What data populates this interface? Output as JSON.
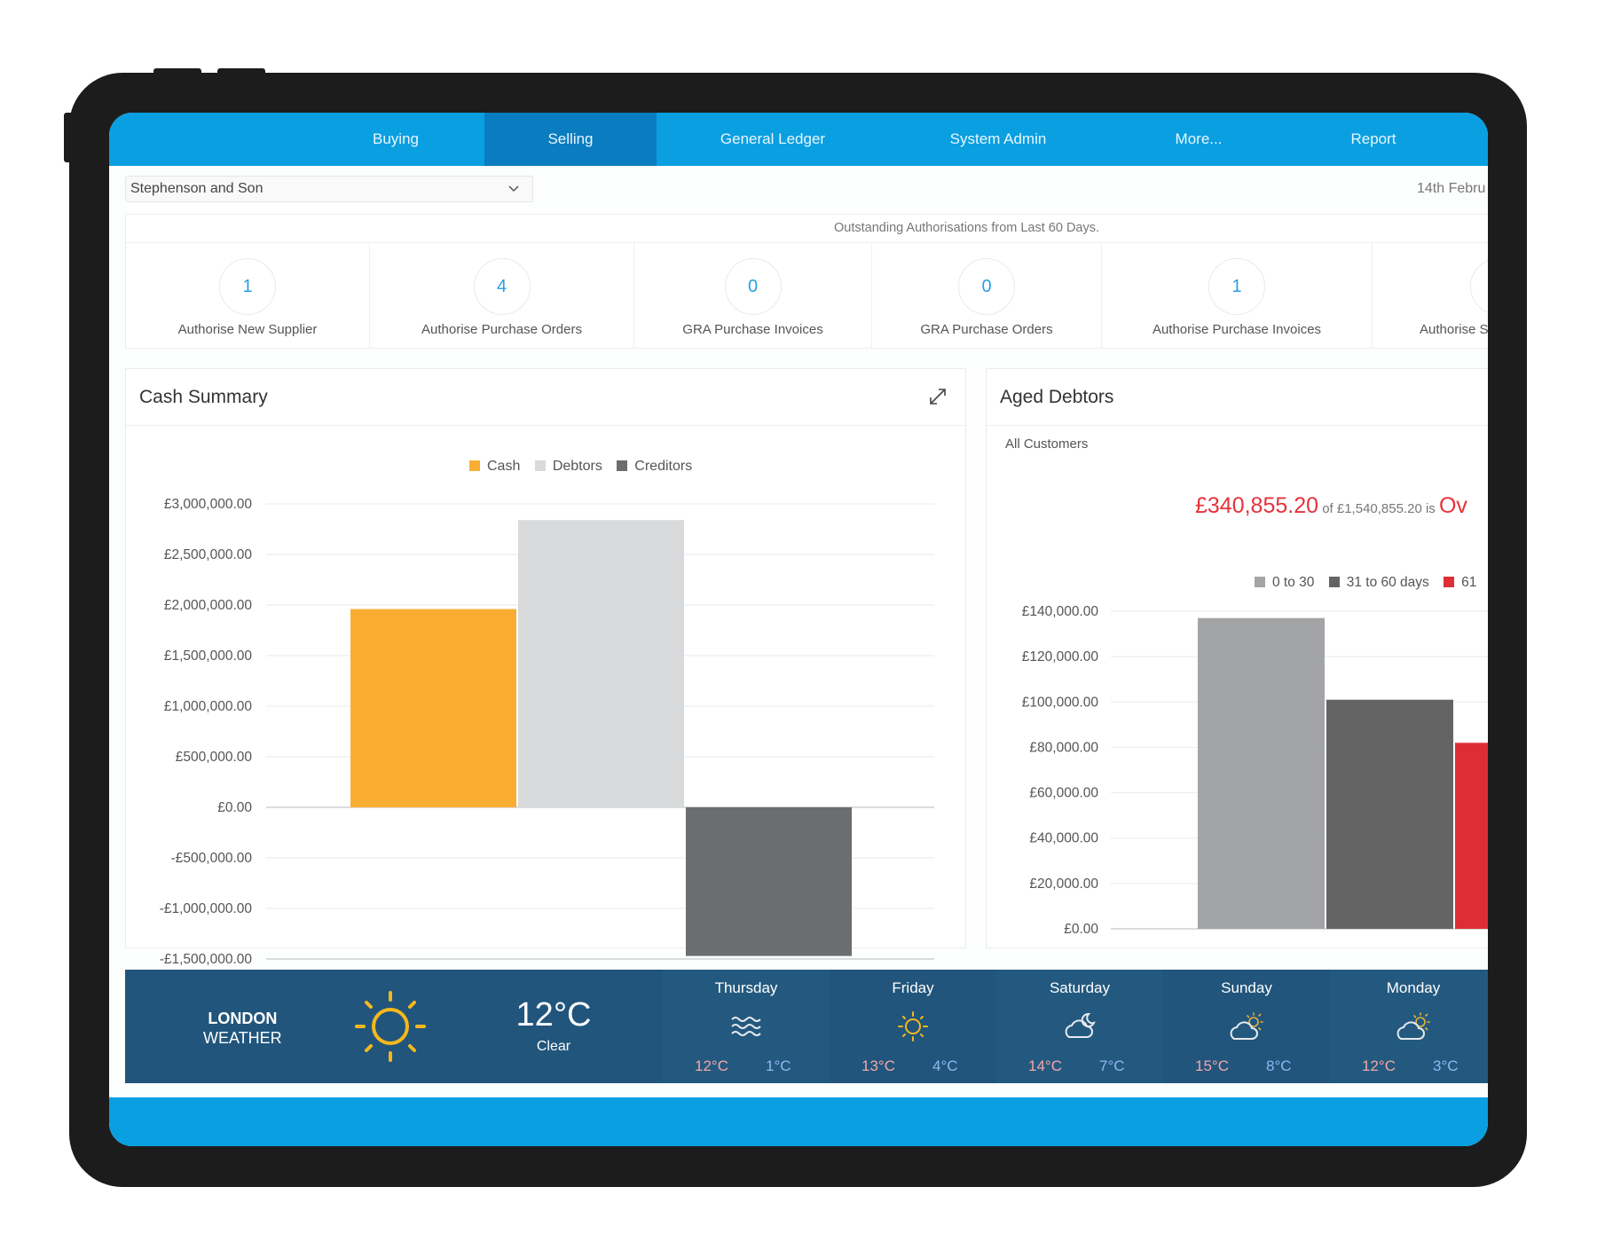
{
  "nav": {
    "tabs": [
      {
        "label": "Buying",
        "active": false
      },
      {
        "label": "Selling",
        "active": true
      },
      {
        "label": "General Ledger",
        "active": false
      },
      {
        "label": "System Admin",
        "active": false
      },
      {
        "label": "More...",
        "active": false
      },
      {
        "label": "Report",
        "active": false
      }
    ],
    "accent_color": "#0a9fe0",
    "active_color": "#0a7cc0"
  },
  "company_select": {
    "value": "Stephenson and Son",
    "icon": "chevron-down-icon"
  },
  "date": "14th Febru",
  "authorisations": {
    "title": "Outstanding Authorisations from Last 60 Days.",
    "items": [
      {
        "count": "1",
        "label": "Authorise New Supplier"
      },
      {
        "count": "4",
        "label": "Authorise Purchase Orders"
      },
      {
        "count": "0",
        "label": "GRA Purchase Invoices"
      },
      {
        "count": "0",
        "label": "GRA Purchase Orders"
      },
      {
        "count": "1",
        "label": "Authorise Purchase Invoices"
      },
      {
        "count": "",
        "label": "Authorise S"
      }
    ]
  },
  "cash_summary": {
    "title": "Cash Summary",
    "expand_icon": "expand-icon"
  },
  "aged_debtors": {
    "title": "Aged Debtors",
    "filter": "All Customers",
    "overdue_amount": "£340,855.20",
    "overdue_text": " of £1,540,855.20 is ",
    "overdue_word": "Ov"
  },
  "chart_data": [
    {
      "type": "bar",
      "title": "Cash Summary",
      "categories": [
        "Cash",
        "Debtors",
        "Creditors"
      ],
      "series": [
        {
          "name": "Cash",
          "color": "#f9ae33",
          "values": [
            1960000
          ]
        },
        {
          "name": "Debtors",
          "color": "#d9dadc",
          "values": [
            2840000
          ]
        },
        {
          "name": "Creditors",
          "color": "#6c6d70",
          "values": [
            -1470000
          ]
        }
      ],
      "yticks": [
        "£3,000,000.00",
        "£2,500,000.00",
        "£2,000,000.00",
        "£1,500,000.00",
        "£1,000,000.00",
        "£500,000.00",
        "£0.00",
        "-£500,000.00",
        "-£1,000,000.00",
        "-£1,500,000.00"
      ],
      "ytick_values": [
        3000000,
        2500000,
        2000000,
        1500000,
        1000000,
        500000,
        0,
        -500000,
        -1000000,
        -1500000
      ],
      "ylim": [
        -1500000,
        3000000
      ],
      "legend": "top-center",
      "grid": true,
      "xlabel": "",
      "ylabel": ""
    },
    {
      "type": "bar",
      "title": "Aged Debtors",
      "categories": [
        "0 to 30",
        "31 to 60 days",
        "61"
      ],
      "series": [
        {
          "name": "0 to 30",
          "color": "#a3a4a6",
          "values": [
            137000
          ]
        },
        {
          "name": "31 to 60 days",
          "color": "#646464",
          "values": [
            101000
          ]
        },
        {
          "name": "61",
          "color": "#dd2e35",
          "values": [
            82000
          ]
        }
      ],
      "yticks": [
        "£140,000.00",
        "£120,000.00",
        "£100,000.00",
        "£80,000.00",
        "£60,000.00",
        "£40,000.00",
        "£20,000.00",
        "£0.00"
      ],
      "ytick_values": [
        140000,
        120000,
        100000,
        80000,
        60000,
        40000,
        20000,
        0
      ],
      "ylim": [
        0,
        140000
      ],
      "legend": "top-right",
      "grid": true,
      "xlabel": "",
      "ylabel": ""
    }
  ],
  "weather": {
    "city": "LONDON",
    "label": "WEATHER",
    "current_icon": "sun-icon",
    "current_temp": "12°C",
    "current_condition": "Clear",
    "forecast": [
      {
        "day": "Thursday",
        "icon": "fog-icon",
        "high": "12°C",
        "low": "1°C"
      },
      {
        "day": "Friday",
        "icon": "sun-icon",
        "high": "13°C",
        "low": "4°C"
      },
      {
        "day": "Saturday",
        "icon": "cloud-moon-icon",
        "high": "14°C",
        "low": "7°C"
      },
      {
        "day": "Sunday",
        "icon": "partly-cloudy-icon",
        "high": "15°C",
        "low": "8°C"
      },
      {
        "day": "Monday",
        "icon": "partly-cloudy-icon",
        "high": "12°C",
        "low": "3°C"
      }
    ]
  }
}
